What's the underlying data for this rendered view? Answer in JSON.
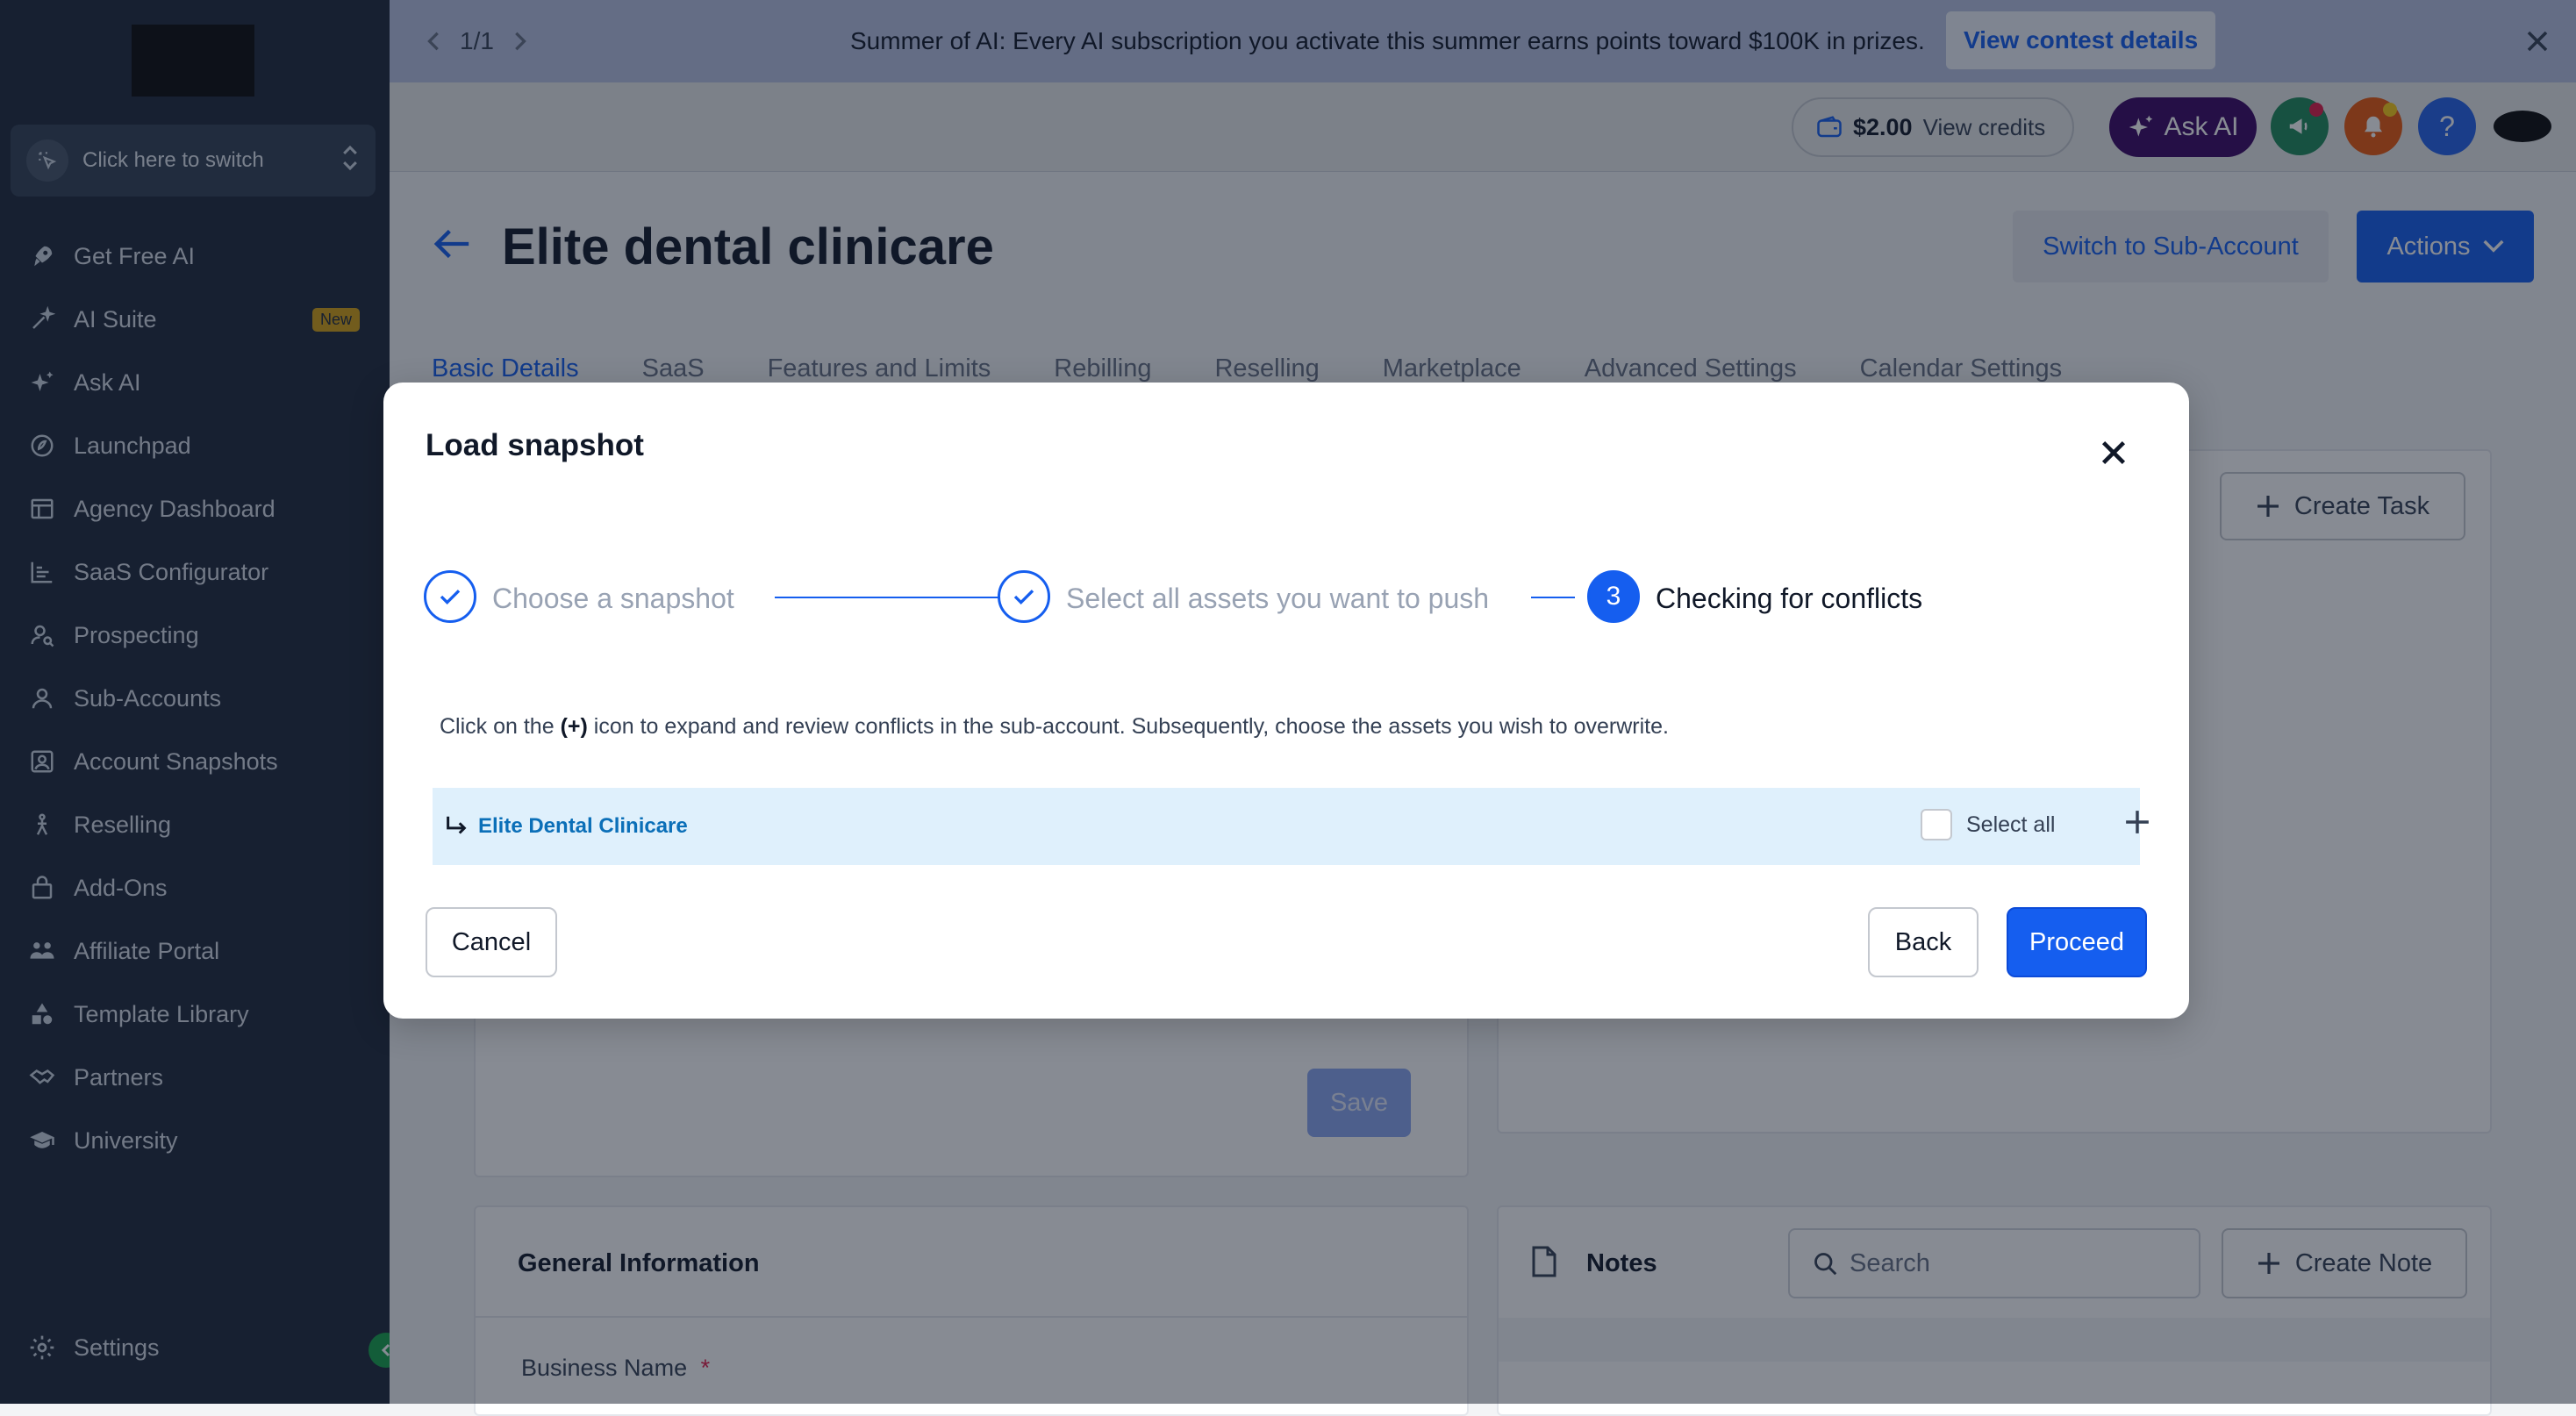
{
  "sidebar": {
    "switcher_label": "Click here to switch",
    "items": [
      {
        "label": "Get Free AI",
        "icon": "rocket-icon"
      },
      {
        "label": "AI Suite",
        "icon": "sparkle-wand-icon",
        "badge": "New"
      },
      {
        "label": "Ask AI",
        "icon": "sparkles-icon"
      },
      {
        "label": "Launchpad",
        "icon": "launchpad-icon"
      },
      {
        "label": "Agency Dashboard",
        "icon": "dashboard-icon"
      },
      {
        "label": "SaaS Configurator",
        "icon": "bar-chart-icon"
      },
      {
        "label": "Prospecting",
        "icon": "user-search-icon"
      },
      {
        "label": "Sub-Accounts",
        "icon": "user-icon"
      },
      {
        "label": "Account Snapshots",
        "icon": "snapshot-icon"
      },
      {
        "label": "Reselling",
        "icon": "reselling-icon"
      },
      {
        "label": "Add-Ons",
        "icon": "bag-icon"
      },
      {
        "label": "Affiliate Portal",
        "icon": "users-icon"
      },
      {
        "label": "Template Library",
        "icon": "shapes-icon"
      },
      {
        "label": "Partners",
        "icon": "handshake-icon"
      },
      {
        "label": "University",
        "icon": "graduation-cap-icon"
      }
    ],
    "settings_label": "Settings"
  },
  "banner": {
    "pager": "1/1",
    "message": "Summer of AI: Every AI subscription you activate this summer earns points toward $100K in prizes.",
    "cta": "View contest details"
  },
  "topbar": {
    "credits_amount": "$2.00",
    "credits_label": "View credits",
    "ask_ai_label": "Ask AI",
    "help_label": "?"
  },
  "page": {
    "title": "Elite dental clinicare",
    "switch_button": "Switch to Sub-Account",
    "actions_button": "Actions",
    "tabs": [
      "Basic Details",
      "SaaS",
      "Features and Limits",
      "Rebilling",
      "Reselling",
      "Marketplace",
      "Advanced Settings",
      "Calendar Settings"
    ],
    "create_task": "Create Task",
    "save": "Save",
    "general_info_title": "General Information",
    "business_name_label": "Business Name",
    "required_mark": "*",
    "notes_title": "Notes",
    "notes_search_placeholder": "Search",
    "create_note": "Create Note"
  },
  "modal": {
    "title": "Load snapshot",
    "steps": [
      {
        "label": "Choose a snapshot",
        "state": "done"
      },
      {
        "label": "Select all assets you want to push",
        "state": "done"
      },
      {
        "label": "Checking for conflicts",
        "state": "current",
        "number": "3"
      }
    ],
    "instruction_pre": "Click on the ",
    "instruction_icon": "(+)",
    "instruction_post": " icon to expand and review conflicts in the sub-account. Subsequently, choose the assets you wish to overwrite.",
    "account_name": "Elite Dental Clinicare",
    "select_all_label": "Select all",
    "select_all_checked": false,
    "cancel": "Cancel",
    "back": "Back",
    "proceed": "Proceed"
  },
  "colors": {
    "sidebar_bg": "#1e293b",
    "primary": "#155eef",
    "banner_bg": "#b9c3e3",
    "ask_ai_bg": "#3b0764",
    "conflict_row_bg": "#dff0fc"
  }
}
